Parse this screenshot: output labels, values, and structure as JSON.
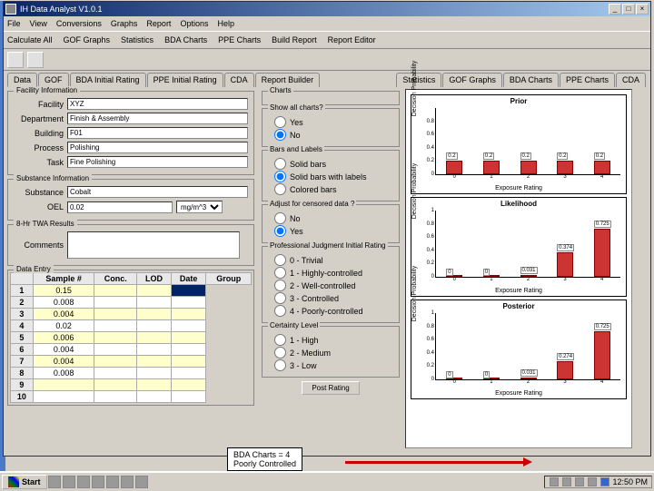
{
  "window": {
    "title": "IH Data Analyst V1.0.1"
  },
  "menu": [
    "File",
    "View",
    "Conversions",
    "Graphs",
    "Report",
    "Options",
    "Help"
  ],
  "toolbar1": [
    "Calculate All",
    "GOF Graphs",
    "Statistics",
    "BDA Charts",
    "PPE Charts",
    "Build Report",
    "Report Editor"
  ],
  "left_tabs": [
    "Data",
    "GOF",
    "BDA Initial Rating",
    "PPE Initial Rating",
    "CDA",
    "Report Builder"
  ],
  "right_tabs": [
    "Statistics",
    "GOF Graphs",
    "BDA Charts",
    "PPE Charts",
    "CDA"
  ],
  "facility": {
    "legend": "Facility Information",
    "facility_label": "Facility",
    "facility_val": "XYZ",
    "dept_label": "Department",
    "dept_val": "Finish & Assembly",
    "bldg_label": "Building",
    "bldg_val": "F01",
    "proc_label": "Process",
    "proc_val": "Polishing",
    "task_label": "Task",
    "task_val": "Fine Polishing"
  },
  "substance": {
    "legend": "Substance Information",
    "name_label": "Substance",
    "name_val": "Cobalt",
    "oel_label": "OEL",
    "oel_val": "0.02",
    "unit": "mg/m^3"
  },
  "twa": {
    "legend": "8-Hr TWA Results",
    "comments_label": "Comments"
  },
  "entry": {
    "legend": "Data Entry",
    "headers": [
      "Sample #",
      "Conc.",
      "LOD",
      "Date",
      "Group"
    ],
    "rows": [
      [
        "1",
        "0.15",
        "",
        "",
        ""
      ],
      [
        "2",
        "0.008",
        "",
        "",
        ""
      ],
      [
        "3",
        "0.004",
        "",
        "",
        ""
      ],
      [
        "4",
        "0.02",
        "",
        "",
        ""
      ],
      [
        "5",
        "0.006",
        "",
        "",
        ""
      ],
      [
        "6",
        "0.004",
        "",
        "",
        ""
      ],
      [
        "7",
        "0.004",
        "",
        "",
        ""
      ],
      [
        "8",
        "0.008",
        "",
        "",
        ""
      ],
      [
        "9",
        "",
        "",
        "",
        ""
      ],
      [
        "10",
        "",
        "",
        "",
        ""
      ]
    ]
  },
  "charts_panel": {
    "legend": "Charts"
  },
  "showall": {
    "legend": "Show all charts?",
    "yes": "Yes",
    "no": "No"
  },
  "bars": {
    "legend": "Bars and Labels",
    "solid": "Solid bars",
    "solid_lbl": "Solid bars with labels",
    "colored": "Colored bars"
  },
  "censor": {
    "legend": "Adjust for censored data ?",
    "no": "No",
    "yes": "Yes"
  },
  "prof": {
    "legend": "Professional Judgment Initial Rating",
    "r0": "0 - Trivial",
    "r1": "1 - Highly-controlled",
    "r2": "2 - Well-controlled",
    "r3": "3 - Controlled",
    "r4": "4 - Poorly-controlled"
  },
  "ctr": {
    "legend": "Certainty Level",
    "high": "1 - High",
    "med": "2 - Medium",
    "low": "3 - Low"
  },
  "postbtn": "Post Rating",
  "annotation": {
    "l1": "BDA Charts = 4",
    "l2": "Poorly Controlled"
  },
  "taskbar": {
    "start": "Start",
    "clock": "12:50 PM"
  },
  "chart_data": [
    {
      "type": "bar",
      "title": "Prior",
      "xlabel": "Exposure Rating",
      "ylabel": "Decision Probability",
      "categories": [
        0,
        1,
        2,
        3,
        4
      ],
      "values": [
        0.2,
        0.2,
        0.2,
        0.2,
        0.2
      ],
      "ylim": [
        0,
        1
      ],
      "yticks": [
        0,
        0.2,
        0.4,
        0.6,
        0.8
      ],
      "color": "#cc3333"
    },
    {
      "type": "bar",
      "title": "Likelihood",
      "xlabel": "Exposure Rating",
      "ylabel": "Decision Probability",
      "categories": [
        0,
        1,
        2,
        3,
        4
      ],
      "values": [
        0,
        0,
        0.031,
        0.374,
        0.725
      ],
      "ylim": [
        0,
        1
      ],
      "yticks": [
        0,
        0.2,
        0.4,
        0.6,
        0.8,
        1
      ],
      "color": "#cc3333"
    },
    {
      "type": "bar",
      "title": "Posterior",
      "xlabel": "Exposure Rating",
      "ylabel": "Decision Probability",
      "categories": [
        0,
        1,
        2,
        3,
        4
      ],
      "values": [
        0,
        0,
        0.031,
        0.274,
        0.725
      ],
      "ylim": [
        0,
        1
      ],
      "yticks": [
        0,
        0.2,
        0.4,
        0.6,
        0.8,
        1
      ],
      "color": "#cc3333"
    }
  ]
}
